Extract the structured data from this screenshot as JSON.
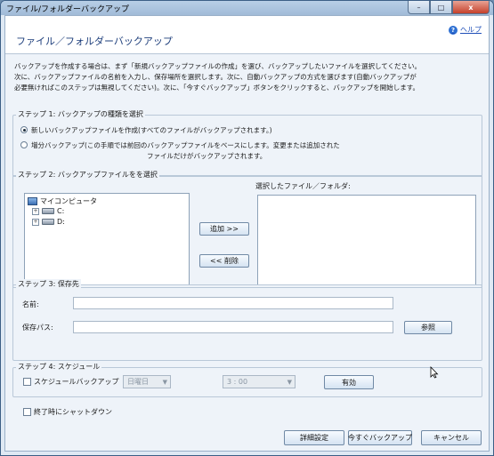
{
  "window": {
    "title": "ファイル/フォルダーバックアップ"
  },
  "header": {
    "title": "ファイル／フォルダーバックアップ",
    "help_label": "ヘルプ"
  },
  "intro": {
    "line1": "バックアップを作成する場合は、まず「新規バックアップファイルの作成」を選び、バックアップしたいファイルを選択してください。",
    "line2": "次に、バックアップファイルの名前を入力し、保存場所を選択します。次に、自動バックアップの方式を選びます(自動バックアップが",
    "line3": "必要無ければこのステップは無視してください)。次に、「今すぐバックアップ」ボタンをクリックすると、バックアップを開始します。"
  },
  "step1": {
    "label": "ステップ 1: バックアップの種類を選択",
    "option_new": "新しいバックアップファイルを作成(すべてのファイルがバックアップされます。)",
    "option_incremental_line1": "増分バックアップ(この手順では前回のバックアップファイルをベースにします。変更または追加された",
    "option_incremental_line2": "ファイルだけがバックアップされます。",
    "selected": "new"
  },
  "step2": {
    "label": "ステップ 2: バックアップファイルをを選択",
    "tree_root": "マイコンピュータ",
    "drives": [
      "C:",
      "D:"
    ],
    "selected_label": "選択したファイル／フォルダ:",
    "add_button": "追加 >>",
    "remove_button": "<< 削除"
  },
  "step3": {
    "label": "ステップ 3: 保存先",
    "name_label": "名前:",
    "name_value": "",
    "path_label": "保存パス:",
    "path_value": "",
    "browse_button": "参照"
  },
  "step4": {
    "label": "ステップ 4: スケジュール",
    "schedule_checkbox": "スケジュールバックアップ",
    "day_value": "日曜日",
    "time_value": "3 : 00",
    "enable_button": "有効"
  },
  "shutdown_checkbox": "終了時にシャットダウン",
  "footer": {
    "advanced_button": "詳細設定",
    "backup_now_button": "今すぐバックアップ",
    "cancel_button": "キャンセル"
  },
  "window_buttons": {
    "minimize": "–",
    "maximize": "□",
    "close": "x"
  },
  "icons": {
    "help": "help-icon",
    "computer": "computer-icon",
    "drive": "drive-icon",
    "expand": "expand-plus-icon",
    "combo_arrow": "chevron-down-icon",
    "cursor": "mouse-cursor-icon"
  },
  "colors": {
    "title_text": "#1b3c7a",
    "accent": "#2d6fd2",
    "close_button": "#c5402b"
  }
}
